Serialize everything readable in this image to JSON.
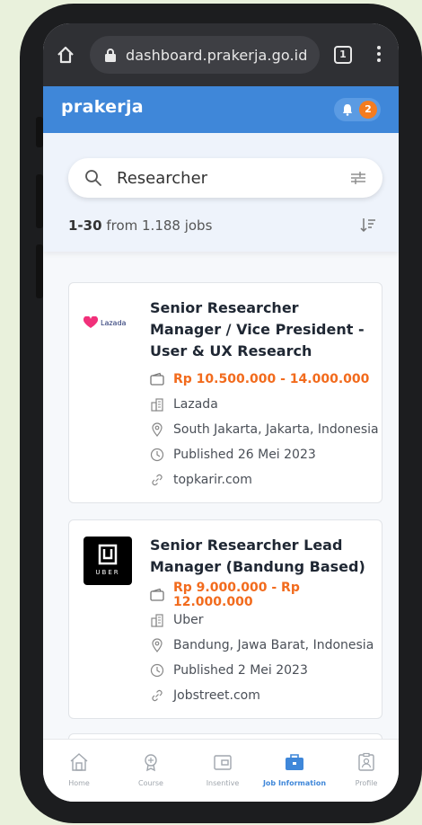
{
  "browser": {
    "url": "dashboard.prakerja.go.id",
    "tab_count": "1"
  },
  "header": {
    "logo": "prakerja",
    "notification_count": "2"
  },
  "search": {
    "value": "Researcher",
    "placeholder": ""
  },
  "results": {
    "range": "1-30",
    "from_text": "from 1.188 jobs"
  },
  "jobs": [
    {
      "title": "Senior Researcher Manager / Vice President - User & UX Research",
      "company_logo_text": "Lazada",
      "salary": "Rp 10.500.000 - 14.000.000",
      "company": "Lazada",
      "location": "South Jakarta, Jakarta, Indonesia",
      "published": "Published 26 Mei 2023",
      "source": "topkarir.com"
    },
    {
      "title": "Senior Researcher Lead Manager (Bandung Based)",
      "company_logo_text": "UBER",
      "salary": "Rp 9.000.000 - Rp 12.000.000",
      "company": "Uber",
      "location": "Bandung, Jawa Barat, Indonesia",
      "published": "Published 2 Mei 2023",
      "source": "Jobstreet.com"
    }
  ],
  "nav": {
    "items": [
      {
        "label": "Home",
        "icon": "home-icon"
      },
      {
        "label": "Course",
        "icon": "course-icon"
      },
      {
        "label": "Insentive",
        "icon": "wallet-icon"
      },
      {
        "label": "Job Information",
        "icon": "briefcase-icon",
        "active": true
      },
      {
        "label": "Profile",
        "icon": "profile-icon"
      }
    ]
  },
  "colors": {
    "brand_blue": "#3f87d9",
    "salary_orange": "#f26b1d",
    "badge_orange": "#f47c20"
  }
}
